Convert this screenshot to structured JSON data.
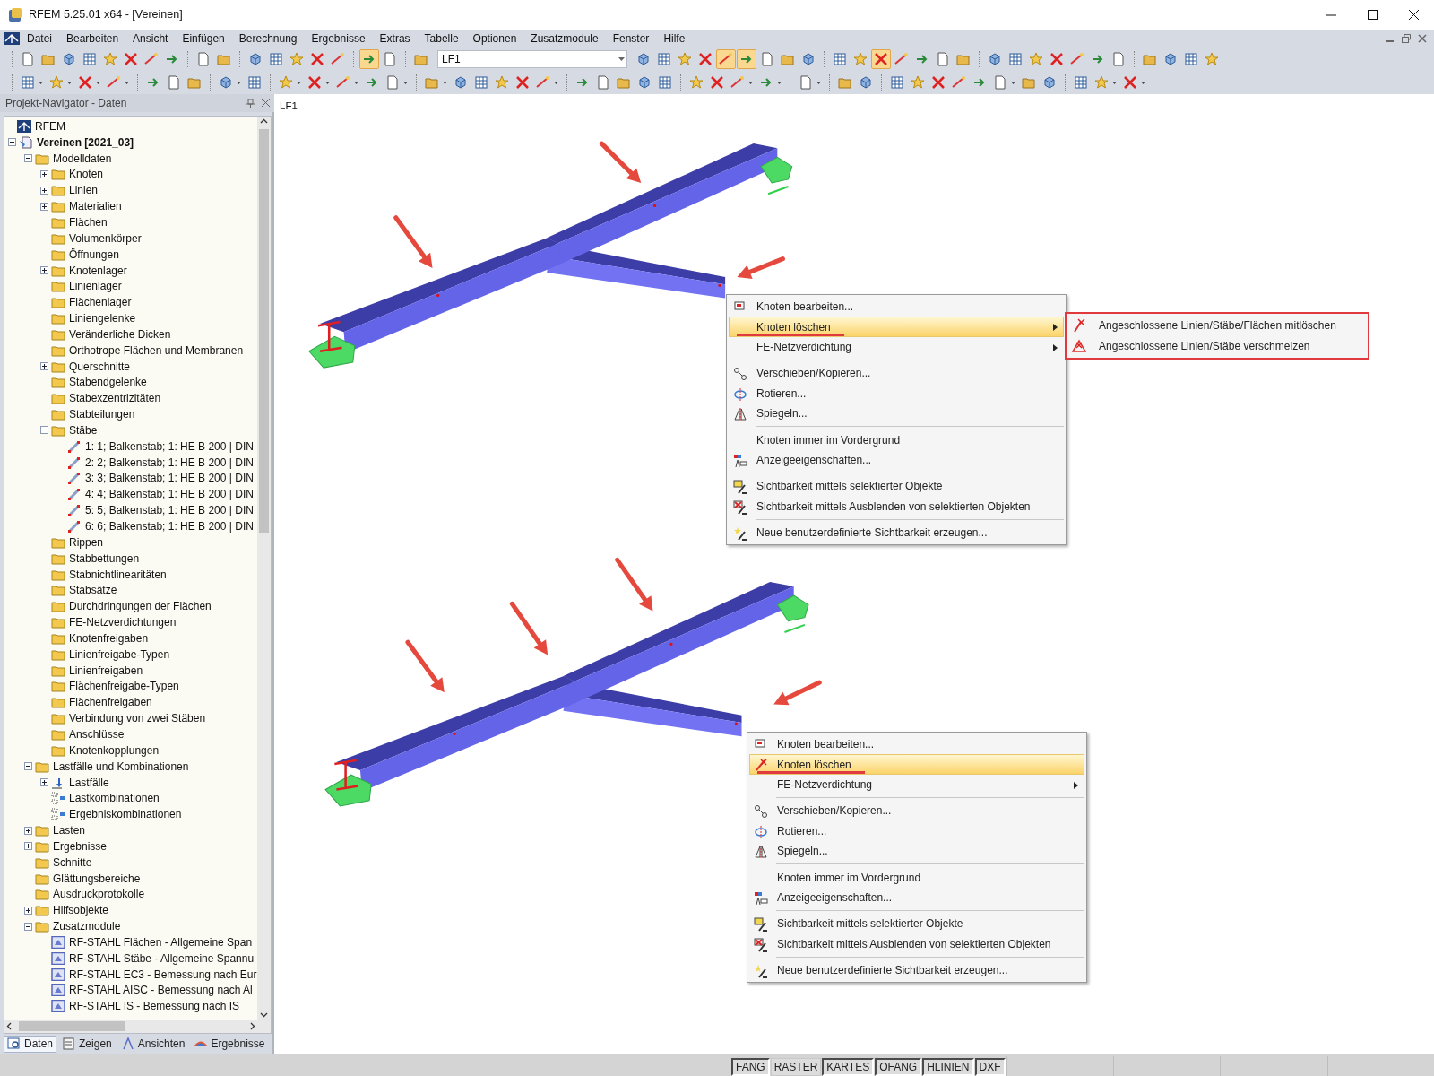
{
  "window": {
    "title": "RFEM 5.25.01 x64 - [Vereinen]"
  },
  "menu_bar": [
    "Datei",
    "Bearbeiten",
    "Ansicht",
    "Einfügen",
    "Berechnung",
    "Ergebnisse",
    "Extras",
    "Tabelle",
    "Optionen",
    "Zusatzmodule",
    "Fenster",
    "Hilfe"
  ],
  "toolbars": [
    {
      "buttons": [
        {
          "kind": "button",
          "on": false
        },
        {
          "kind": "button",
          "on": false
        },
        {
          "kind": "button",
          "on": false
        },
        {
          "kind": "button",
          "on": false
        },
        {
          "kind": "button",
          "on": false
        },
        {
          "kind": "button",
          "on": false
        },
        {
          "kind": "button",
          "on": false
        },
        {
          "kind": "button",
          "on": false
        },
        {
          "kind": "separator"
        },
        {
          "kind": "button",
          "on": false
        },
        {
          "kind": "button",
          "on": false
        },
        {
          "kind": "separator"
        },
        {
          "kind": "button",
          "on": false
        },
        {
          "kind": "button",
          "on": false
        },
        {
          "kind": "button",
          "on": false
        },
        {
          "kind": "button",
          "on": false
        },
        {
          "kind": "button",
          "on": false
        },
        {
          "kind": "separator"
        },
        {
          "kind": "button",
          "on": true
        },
        {
          "kind": "button",
          "on": false
        },
        {
          "kind": "separator"
        },
        {
          "kind": "button",
          "on": false
        },
        {
          "kind": "combo",
          "value": "LF1"
        },
        {
          "kind": "button",
          "on": false
        },
        {
          "kind": "button",
          "on": false
        },
        {
          "kind": "button",
          "on": false
        },
        {
          "kind": "button",
          "on": false
        },
        {
          "kind": "button",
          "on": true
        },
        {
          "kind": "button",
          "on": true
        },
        {
          "kind": "button",
          "on": false
        },
        {
          "kind": "button",
          "on": false
        },
        {
          "kind": "button",
          "on": false
        },
        {
          "kind": "separator"
        },
        {
          "kind": "button",
          "on": false
        },
        {
          "kind": "button",
          "on": false
        },
        {
          "kind": "button",
          "on": true
        },
        {
          "kind": "button",
          "on": false
        },
        {
          "kind": "button",
          "on": false
        },
        {
          "kind": "button",
          "on": false
        },
        {
          "kind": "button",
          "on": false
        },
        {
          "kind": "separator"
        },
        {
          "kind": "button",
          "on": false
        },
        {
          "kind": "button",
          "on": false
        },
        {
          "kind": "button",
          "on": false
        },
        {
          "kind": "button",
          "on": false
        },
        {
          "kind": "button",
          "on": false
        },
        {
          "kind": "button",
          "on": false
        },
        {
          "kind": "button",
          "on": false
        },
        {
          "kind": "separator"
        },
        {
          "kind": "button",
          "on": false
        },
        {
          "kind": "button",
          "on": false
        },
        {
          "kind": "button",
          "on": false
        },
        {
          "kind": "button",
          "on": false
        }
      ]
    },
    {
      "buttons": [
        {
          "kind": "dropdown",
          "on": false
        },
        {
          "kind": "dropdown",
          "on": false
        },
        {
          "kind": "dropdown",
          "on": false
        },
        {
          "kind": "dropdown",
          "on": false
        },
        {
          "kind": "separator"
        },
        {
          "kind": "button",
          "on": false
        },
        {
          "kind": "button",
          "on": false
        },
        {
          "kind": "button",
          "on": false
        },
        {
          "kind": "separator"
        },
        {
          "kind": "dropdown",
          "on": false
        },
        {
          "kind": "button",
          "on": false
        },
        {
          "kind": "separator"
        },
        {
          "kind": "dropdown",
          "on": false
        },
        {
          "kind": "dropdown",
          "on": false
        },
        {
          "kind": "dropdown",
          "on": false
        },
        {
          "kind": "button",
          "on": false
        },
        {
          "kind": "dropdown",
          "on": false
        },
        {
          "kind": "separator"
        },
        {
          "kind": "dropdown",
          "on": false
        },
        {
          "kind": "button",
          "on": false
        },
        {
          "kind": "button",
          "on": false
        },
        {
          "kind": "button",
          "on": false
        },
        {
          "kind": "button",
          "on": false
        },
        {
          "kind": "dropdown",
          "on": false
        },
        {
          "kind": "separator"
        },
        {
          "kind": "button",
          "on": false
        },
        {
          "kind": "button",
          "on": false
        },
        {
          "kind": "button",
          "on": false
        },
        {
          "kind": "button",
          "on": false
        },
        {
          "kind": "button",
          "on": false
        },
        {
          "kind": "separator"
        },
        {
          "kind": "button",
          "on": false
        },
        {
          "kind": "button",
          "on": false
        },
        {
          "kind": "dropdown",
          "on": false
        },
        {
          "kind": "dropdown",
          "on": false
        },
        {
          "kind": "separator"
        },
        {
          "kind": "dropdown",
          "on": false
        },
        {
          "kind": "separator"
        },
        {
          "kind": "button",
          "on": false
        },
        {
          "kind": "button",
          "on": false
        },
        {
          "kind": "separator"
        },
        {
          "kind": "button",
          "on": false
        },
        {
          "kind": "button",
          "on": false
        },
        {
          "kind": "button",
          "on": false
        },
        {
          "kind": "button",
          "on": false
        },
        {
          "kind": "button",
          "on": false
        },
        {
          "kind": "dropdown",
          "on": false
        },
        {
          "kind": "button",
          "on": false
        },
        {
          "kind": "button",
          "on": false
        },
        {
          "kind": "separator"
        },
        {
          "kind": "button",
          "on": false
        },
        {
          "kind": "dropdown",
          "on": false
        },
        {
          "kind": "dropdown",
          "on": false
        }
      ]
    }
  ],
  "navigator": {
    "title": "Projekt-Navigator - Daten",
    "root": "RFEM",
    "project": {
      "label": "Vereinen [2021_03]",
      "expanded": true,
      "children": [
        {
          "label": "Modelldaten",
          "kind": "folder",
          "expanded": true,
          "children": [
            {
              "label": "Knoten",
              "kind": "folder",
              "expanded": false
            },
            {
              "label": "Linien",
              "kind": "folder",
              "expanded": false
            },
            {
              "label": "Materialien",
              "kind": "folder",
              "expanded": false
            },
            {
              "label": "Flächen",
              "kind": "folder"
            },
            {
              "label": "Volumenkörper",
              "kind": "folder"
            },
            {
              "label": "Öffnungen",
              "kind": "folder"
            },
            {
              "label": "Knotenlager",
              "kind": "folder",
              "expanded": false
            },
            {
              "label": "Linienlager",
              "kind": "folder"
            },
            {
              "label": "Flächenlager",
              "kind": "folder"
            },
            {
              "label": "Liniengelenke",
              "kind": "folder"
            },
            {
              "label": "Veränderliche Dicken",
              "kind": "folder"
            },
            {
              "label": "Orthotrope Flächen und Membranen",
              "kind": "folder"
            },
            {
              "label": "Querschnitte",
              "kind": "folder",
              "expanded": false
            },
            {
              "label": "Stabendgelenke",
              "kind": "folder"
            },
            {
              "label": "Stabexzentrizitäten",
              "kind": "folder"
            },
            {
              "label": "Stabteilungen",
              "kind": "folder"
            },
            {
              "label": "Stäbe",
              "kind": "folder",
              "expanded": true,
              "children": [
                {
                  "label": "1: 1; Balkenstab; 1: HE B 200 | DIN",
                  "kind": "member"
                },
                {
                  "label": "2: 2; Balkenstab; 1: HE B 200 | DIN",
                  "kind": "member"
                },
                {
                  "label": "3: 3; Balkenstab; 1: HE B 200 | DIN",
                  "kind": "member"
                },
                {
                  "label": "4: 4; Balkenstab; 1: HE B 200 | DIN",
                  "kind": "member"
                },
                {
                  "label": "5: 5; Balkenstab; 1: HE B 200 | DIN",
                  "kind": "member"
                },
                {
                  "label": "6: 6; Balkenstab; 1: HE B 200 | DIN",
                  "kind": "member"
                }
              ]
            },
            {
              "label": "Rippen",
              "kind": "folder"
            },
            {
              "label": "Stabbettungen",
              "kind": "folder"
            },
            {
              "label": "Stabnichtlinearitäten",
              "kind": "folder"
            },
            {
              "label": "Stabsätze",
              "kind": "folder"
            },
            {
              "label": "Durchdringungen der Flächen",
              "kind": "folder"
            },
            {
              "label": "FE-Netzverdichtungen",
              "kind": "folder"
            },
            {
              "label": "Knotenfreigaben",
              "kind": "folder"
            },
            {
              "label": "Linienfreigabe-Typen",
              "kind": "folder"
            },
            {
              "label": "Linienfreigaben",
              "kind": "folder"
            },
            {
              "label": "Flächenfreigabe-Typen",
              "kind": "folder"
            },
            {
              "label": "Flächenfreigaben",
              "kind": "folder"
            },
            {
              "label": "Verbindung von zwei Stäben",
              "kind": "folder"
            },
            {
              "label": "Anschlüsse",
              "kind": "folder"
            },
            {
              "label": "Knotenkopplungen",
              "kind": "folder"
            }
          ]
        },
        {
          "label": "Lastfälle und Kombinationen",
          "kind": "folder",
          "expanded": true,
          "children": [
            {
              "label": "Lastfälle",
              "kind": "load",
              "expanded": false
            },
            {
              "label": "Lastkombinationen",
              "kind": "combination"
            },
            {
              "label": "Ergebniskombinationen",
              "kind": "combination"
            }
          ]
        },
        {
          "label": "Lasten",
          "kind": "folder",
          "expanded": false
        },
        {
          "label": "Ergebnisse",
          "kind": "folder",
          "expanded": false
        },
        {
          "label": "Schnitte",
          "kind": "folder"
        },
        {
          "label": "Glättungsbereiche",
          "kind": "folder"
        },
        {
          "label": "Ausdruckprotokolle",
          "kind": "folder"
        },
        {
          "label": "Hilfsobjekte",
          "kind": "folder",
          "expanded": false
        },
        {
          "label": "Zusatzmodule",
          "kind": "folder",
          "expanded": true,
          "children": [
            {
              "label": "RF-STAHL Flächen - Allgemeine Span",
              "kind": "module"
            },
            {
              "label": "RF-STAHL Stäbe - Allgemeine Spannu",
              "kind": "module"
            },
            {
              "label": "RF-STAHL EC3 - Bemessung nach Eur",
              "kind": "module"
            },
            {
              "label": "RF-STAHL AISC - Bemessung nach Al",
              "kind": "module"
            },
            {
              "label": "RF-STAHL IS - Bemessung nach IS",
              "kind": "module"
            }
          ]
        }
      ]
    },
    "tabs": [
      {
        "label": "Daten",
        "selected": true
      },
      {
        "label": "Zeigen",
        "selected": false
      },
      {
        "label": "Ansichten",
        "selected": false
      },
      {
        "label": "Ergebnisse",
        "selected": false
      }
    ]
  },
  "view": {
    "label": "LF1"
  },
  "context_menus": [
    {
      "items": [
        {
          "kind": "item",
          "label": "Knoten bearbeiten...",
          "icon": true,
          "selected": false,
          "submenu": false,
          "underlined": false
        },
        {
          "kind": "item",
          "label": "Knoten löschen",
          "icon": false,
          "selected": true,
          "submenu": true,
          "underlined": true
        },
        {
          "kind": "item",
          "label": "FE-Netzverdichtung",
          "icon": false,
          "selected": false,
          "submenu": true,
          "underlined": false
        },
        {
          "kind": "separator"
        },
        {
          "kind": "item",
          "label": "Verschieben/Kopieren...",
          "icon": true,
          "selected": false,
          "submenu": false,
          "underlined": false
        },
        {
          "kind": "item",
          "label": "Rotieren...",
          "icon": true,
          "selected": false,
          "submenu": false,
          "underlined": false
        },
        {
          "kind": "item",
          "label": "Spiegeln...",
          "icon": true,
          "selected": false,
          "submenu": false,
          "underlined": false
        },
        {
          "kind": "separator"
        },
        {
          "kind": "item",
          "label": "Knoten immer im Vordergrund",
          "icon": false,
          "selected": false,
          "submenu": false,
          "underlined": false
        },
        {
          "kind": "item",
          "label": "Anzeigeeigenschaften...",
          "icon": true,
          "selected": false,
          "submenu": false,
          "underlined": false
        },
        {
          "kind": "separator"
        },
        {
          "kind": "item",
          "label": "Sichtbarkeit mittels selektierter Objekte",
          "icon": true,
          "selected": false,
          "submenu": false,
          "underlined": false
        },
        {
          "kind": "item",
          "label": "Sichtbarkeit mittels Ausblenden von selektierten Objekten",
          "icon": true,
          "selected": false,
          "submenu": false,
          "underlined": false
        },
        {
          "kind": "separator"
        },
        {
          "kind": "item",
          "label": "Neue benutzerdefinierte Sichtbarkeit erzeugen...",
          "icon": true,
          "selected": false,
          "submenu": false,
          "underlined": false
        }
      ],
      "submenu_panel": {
        "outlined": true,
        "items": [
          {
            "label": "Angeschlossene Linien/Stäbe/Flächen mitlöschen"
          },
          {
            "label": "Angeschlossene Linien/Stäbe verschmelzen"
          }
        ]
      }
    },
    {
      "items": [
        {
          "kind": "item",
          "label": "Knoten bearbeiten...",
          "icon": true,
          "selected": false,
          "submenu": false,
          "underlined": false
        },
        {
          "kind": "item",
          "label": "Knoten löschen",
          "icon": true,
          "selected": true,
          "submenu": false,
          "underlined": true
        },
        {
          "kind": "item",
          "label": "FE-Netzverdichtung",
          "icon": false,
          "selected": false,
          "submenu": true,
          "underlined": false
        },
        {
          "kind": "separator"
        },
        {
          "kind": "item",
          "label": "Verschieben/Kopieren...",
          "icon": true,
          "selected": false,
          "submenu": false,
          "underlined": false
        },
        {
          "kind": "item",
          "label": "Rotieren...",
          "icon": true,
          "selected": false,
          "submenu": false,
          "underlined": false
        },
        {
          "kind": "item",
          "label": "Spiegeln...",
          "icon": true,
          "selected": false,
          "submenu": false,
          "underlined": false
        },
        {
          "kind": "separator"
        },
        {
          "kind": "item",
          "label": "Knoten immer im Vordergrund",
          "icon": false,
          "selected": false,
          "submenu": false,
          "underlined": false
        },
        {
          "kind": "item",
          "label": "Anzeigeeigenschaften...",
          "icon": true,
          "selected": false,
          "submenu": false,
          "underlined": false
        },
        {
          "kind": "separator"
        },
        {
          "kind": "item",
          "label": "Sichtbarkeit mittels selektierter Objekte",
          "icon": true,
          "selected": false,
          "submenu": false,
          "underlined": false
        },
        {
          "kind": "item",
          "label": "Sichtbarkeit mittels Ausblenden von selektierten Objekten",
          "icon": true,
          "selected": false,
          "submenu": false,
          "underlined": false
        },
        {
          "kind": "separator"
        },
        {
          "kind": "item",
          "label": "Neue benutzerdefinierte Sichtbarkeit erzeugen...",
          "icon": true,
          "selected": false,
          "submenu": false,
          "underlined": false
        }
      ]
    }
  ],
  "status_bar": [
    {
      "label": "FANG",
      "pressed": true
    },
    {
      "label": "RASTER",
      "pressed": false
    },
    {
      "label": "KARTES",
      "pressed": true
    },
    {
      "label": "OFANG",
      "pressed": true
    },
    {
      "label": "HLINIEN",
      "pressed": true
    },
    {
      "label": "DXF",
      "pressed": true
    }
  ]
}
